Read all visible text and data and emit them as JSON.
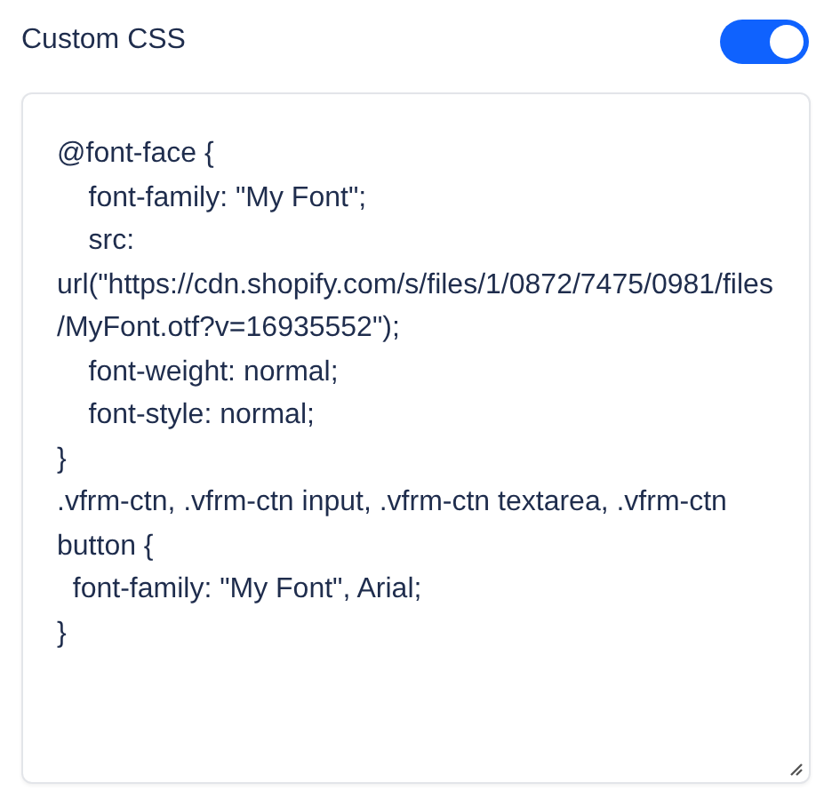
{
  "header": {
    "title": "Custom CSS",
    "toggle": {
      "on": true
    }
  },
  "editor": {
    "value": "@font-face {\n    font-family: \"My Font\";\n    src: url(\"https://cdn.shopify.com/s/files/1/0872/7475/0981/files/MyFont.otf?v=16935552\");\n    font-weight: normal;\n    font-style: normal;\n}\n.vfrm-ctn, .vfrm-ctn input, .vfrm-ctn textarea, .vfrm-ctn button {\n  font-family: \"My Font\", Arial;\n}"
  }
}
